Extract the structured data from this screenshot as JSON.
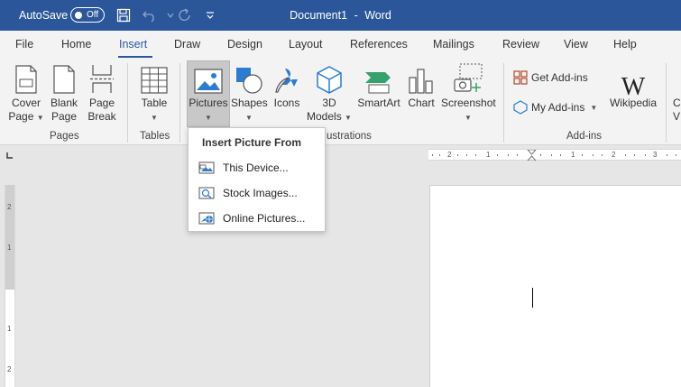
{
  "titlebar": {
    "autosave_label": "AutoSave",
    "autosave_state": "Off",
    "doc_name": "Document1",
    "separator": "-",
    "app_name": "Word"
  },
  "tabs": [
    {
      "label": "File"
    },
    {
      "label": "Home"
    },
    {
      "label": "Insert"
    },
    {
      "label": "Draw"
    },
    {
      "label": "Design"
    },
    {
      "label": "Layout"
    },
    {
      "label": "References"
    },
    {
      "label": "Mailings"
    },
    {
      "label": "Review"
    },
    {
      "label": "View"
    },
    {
      "label": "Help"
    }
  ],
  "ribbon": {
    "cover_page": {
      "line1": "Cover",
      "line2": "Page"
    },
    "blank_page": {
      "line1": "Blank",
      "line2": "Page"
    },
    "page_break": {
      "line1": "Page",
      "line2": "Break"
    },
    "table": {
      "label": "Table"
    },
    "pictures": {
      "label": "Pictures"
    },
    "shapes": {
      "label": "Shapes"
    },
    "icons": {
      "label": "Icons"
    },
    "models_3d": {
      "line1": "3D",
      "line2": "Models"
    },
    "smartart": {
      "label": "SmartArt"
    },
    "chart": {
      "label": "Chart"
    },
    "screenshot": {
      "label": "Screenshot"
    },
    "get_addins": {
      "label": "Get Add-ins"
    },
    "my_addins": {
      "label": "My Add-ins"
    },
    "wikipedia": {
      "label": "Wikipedia"
    },
    "cut_off_letter1": "C",
    "cut_off_letter2": "V",
    "groups": {
      "pages": "Pages",
      "tables": "Tables",
      "illustrations_partial": "ustrations",
      "addins": "Add-ins"
    }
  },
  "dropdown": {
    "title": "Insert Picture From",
    "items": [
      {
        "label": "This Device..."
      },
      {
        "label": "Stock Images..."
      },
      {
        "label": "Online Pictures..."
      }
    ]
  },
  "ruler": {
    "h_labels": [
      "2",
      "1",
      "1",
      "2",
      "3"
    ],
    "v_labels": [
      "2",
      "1",
      "1",
      "2"
    ]
  },
  "colors": {
    "title_bar": "#2b579a",
    "accent": "#2b579a",
    "ribbon_bg": "#f3f3f3",
    "canvas_bg": "#e6e6e6"
  }
}
